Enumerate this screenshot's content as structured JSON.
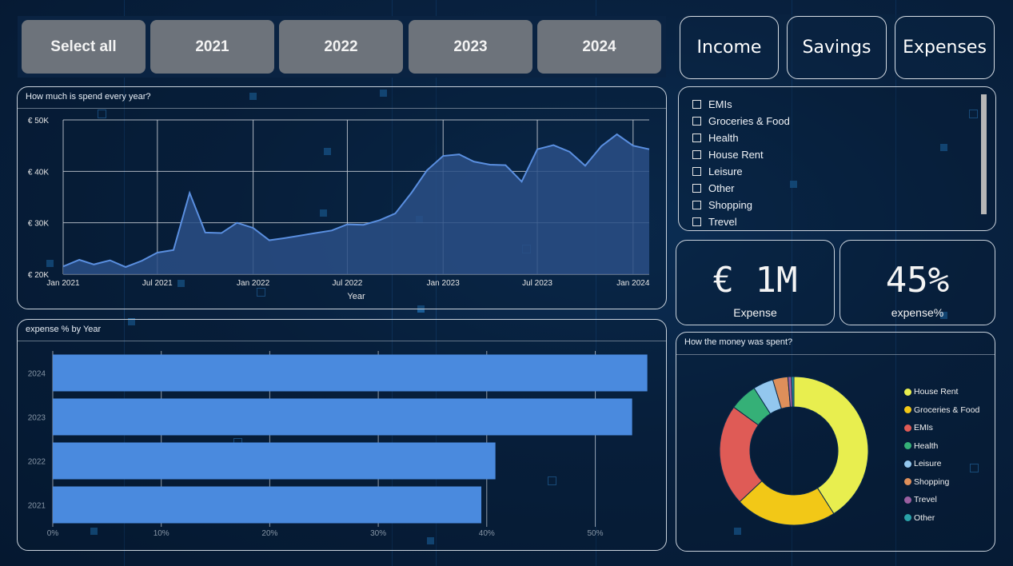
{
  "year_slicer": {
    "buttons": [
      {
        "label": "Select all"
      },
      {
        "label": "2021"
      },
      {
        "label": "2022"
      },
      {
        "label": "2023"
      },
      {
        "label": "2024"
      }
    ]
  },
  "category_buttons": [
    {
      "label": "Income"
    },
    {
      "label": "Savings"
    },
    {
      "label": "Expenses"
    }
  ],
  "category_list": {
    "items": [
      "EMIs",
      "Groceries & Food",
      "Health",
      "House Rent",
      "Leisure",
      "Other",
      "Shopping",
      "Trevel"
    ]
  },
  "kpis": [
    {
      "value": "€ 1M",
      "label": "Expense"
    },
    {
      "value": "45%",
      "label": "expense%"
    }
  ],
  "colors": {
    "line": "#5a8fe0",
    "area": "#2a4f86",
    "bar": "#4a8ade",
    "background": "#08213f"
  },
  "chart_data": [
    {
      "type": "area",
      "title": "How much is spend every year?",
      "xlabel": "Year",
      "ylabel": "",
      "x_ticks": [
        "Jan 2021",
        "Jul 2021",
        "Jan 2022",
        "Jul 2022",
        "Jan 2023",
        "Jul 2023",
        "Jan 2024"
      ],
      "y_ticks": [
        "€ 20K",
        "€ 30K",
        "€ 40K",
        "€ 50K"
      ],
      "ylim": [
        20000,
        50000
      ],
      "x": [
        "2021-01",
        "2021-02",
        "2021-03",
        "2021-04",
        "2021-05",
        "2021-06",
        "2021-07",
        "2021-08",
        "2021-09",
        "2021-10",
        "2021-11",
        "2021-12",
        "2022-01",
        "2022-02",
        "2022-03",
        "2022-04",
        "2022-05",
        "2022-06",
        "2022-07",
        "2022-08",
        "2022-09",
        "2022-10",
        "2022-11",
        "2022-12",
        "2023-01",
        "2023-02",
        "2023-03",
        "2023-04",
        "2023-05",
        "2023-06",
        "2023-07",
        "2023-08",
        "2023-09",
        "2023-10",
        "2023-11",
        "2023-12",
        "2024-01",
        "2024-02"
      ],
      "values": [
        21500,
        22800,
        21900,
        22700,
        21400,
        22600,
        24200,
        24700,
        35800,
        28100,
        28000,
        30000,
        29000,
        26600,
        27000,
        27500,
        28000,
        28500,
        29700,
        29600,
        30500,
        31800,
        35800,
        40200,
        43000,
        43300,
        41900,
        41300,
        41200,
        38000,
        44300,
        45100,
        43800,
        41100,
        44900,
        47200,
        45000,
        44300
      ],
      "grid": true
    },
    {
      "type": "bar",
      "title": "expense % by Year",
      "orientation": "horizontal",
      "categories": [
        "2024",
        "2023",
        "2022",
        "2021"
      ],
      "values": [
        54.8,
        53.4,
        40.8,
        39.5
      ],
      "x_ticks": [
        "0%",
        "10%",
        "20%",
        "30%",
        "40%",
        "50%"
      ],
      "xlim": [
        0,
        55
      ],
      "grid": true
    },
    {
      "type": "pie",
      "title": "How the money was spent?",
      "donut": true,
      "legend_position": "right",
      "categories": [
        "House Rent",
        "Groceries & Food",
        "EMIs",
        "Health",
        "Leisure",
        "Shopping",
        "Trevel",
        "Other"
      ],
      "values": [
        41,
        22,
        22,
        6,
        4.4,
        3.3,
        0.8,
        0.5
      ],
      "colors": [
        "#e8ee4f",
        "#f2c817",
        "#df5b56",
        "#35b077",
        "#93c7ee",
        "#de8f5a",
        "#9a5fa0",
        "#2aa2a8"
      ]
    }
  ]
}
